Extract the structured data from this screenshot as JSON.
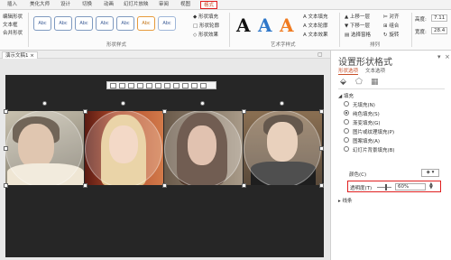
{
  "tabs": [
    "插入",
    "美化大师",
    "设计",
    "切换",
    "动画",
    "幻灯片放映",
    "审阅",
    "视图",
    "格式"
  ],
  "ribbon": {
    "left_items": [
      "编辑形状",
      "文本框",
      "合并形状"
    ],
    "style_box_label": "Abc",
    "shape_fill": "形状填充",
    "shape_outline": "形状轮廓",
    "shape_effects": "形状效果",
    "group_shape_styles": "形状样式",
    "wordart_letter": "A",
    "text_fill": "文本填充",
    "text_outline": "文本轮廓",
    "text_effects": "文本效果",
    "group_wordart": "艺术字样式",
    "bring_forward": "上移一层",
    "send_backward": "下移一层",
    "selection_pane": "选择窗格",
    "align": "对齐",
    "group": "组合",
    "rotate": "旋转",
    "group_arrange": "排列",
    "height_label": "高度:",
    "height_value": "7.11",
    "width_label": "宽度:",
    "width_value": "28.4"
  },
  "doc": {
    "tab_label": "演示文稿1"
  },
  "pane": {
    "title": "设置形状格式",
    "tab_shape": "形状选项",
    "tab_text": "文本选项",
    "fill_header": "填充",
    "fill_options": [
      "无填充(N)",
      "纯色填充(S)",
      "渐变填充(G)",
      "图片或纹理填充(P)",
      "图案填充(A)",
      "幻灯片背景填充(B)"
    ],
    "selected_fill": 1,
    "color_label": "颜色(C)",
    "transparency_label": "透明度(T)",
    "transparency_value": "60%",
    "transparency_fraction": 0.6,
    "line_header": "线条"
  },
  "colors": {
    "accent_red": "#e02020",
    "slide_bg": "#262626",
    "wordart_black": "#111111",
    "wordart_blue": "#2f77c9",
    "wordart_orange": "#f07b21"
  }
}
